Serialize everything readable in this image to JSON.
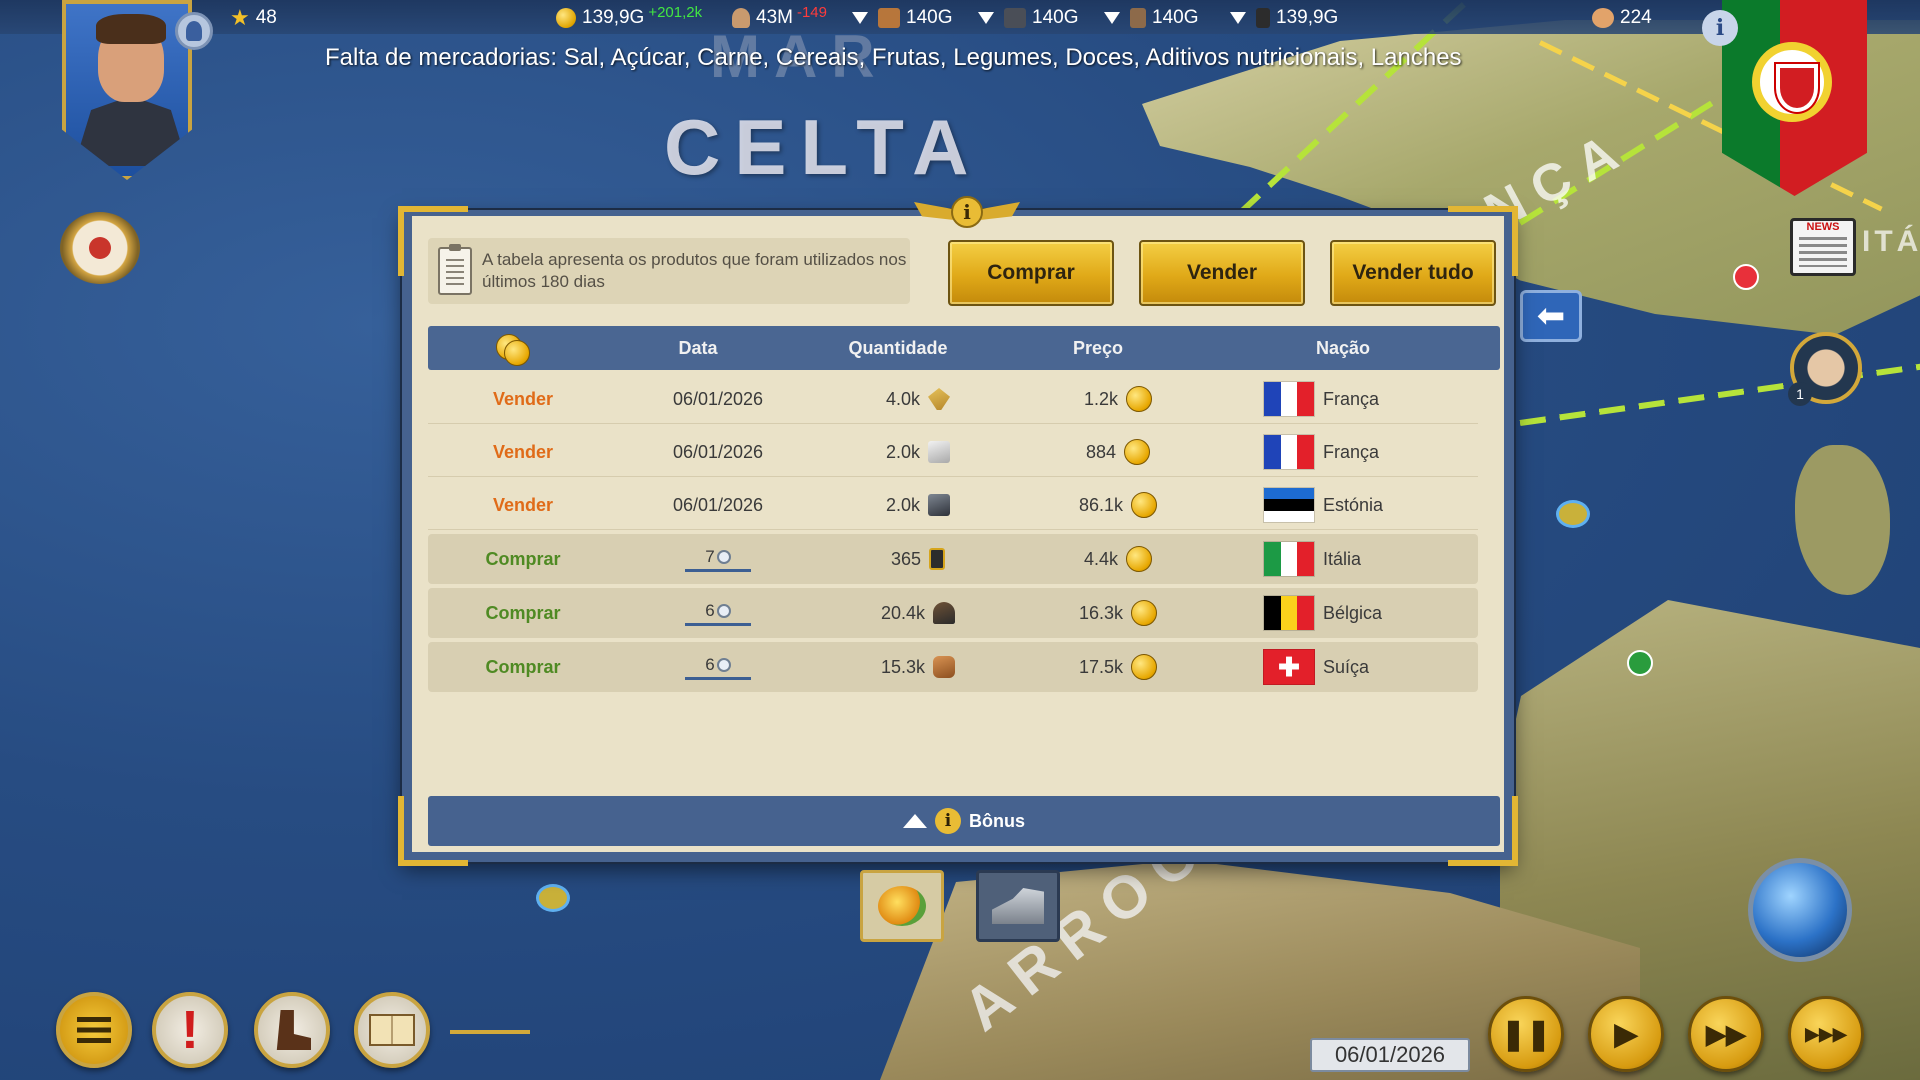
{
  "top_bar": {
    "stars": "48",
    "money": "139,9G",
    "money_delta": "+201,2k",
    "population": "43M",
    "population_delta": "-149",
    "res_1": "140G",
    "res_2": "140G",
    "res_3": "140G",
    "res_4": "139,9G",
    "strength": "224"
  },
  "shortage_text": "Falta de mercadorias: Sal, Açúcar, Carne, Cereais, Frutas, Legumes, Doces, Aditivos nutricionais, Lanches",
  "map": {
    "sea_label_1": "MAR",
    "sea_label_2": "CELTA",
    "country_label_france": "NÇA",
    "country_label_morocco": "ARROCOS",
    "country_label_italy": "ITÁ"
  },
  "news_label": "NEWS",
  "advisor_badge": "1",
  "dialog": {
    "note": "A tabela apresenta os produtos que foram utilizados nos últimos 180 dias",
    "buy_button": "Comprar",
    "sell_button": "Vender",
    "sell_all_button": "Vender tudo",
    "headers": {
      "date": "Data",
      "quantity": "Quantidade",
      "price": "Preço",
      "nation": "Nação"
    },
    "rows": [
      {
        "action": "Vender",
        "date": "06/01/2026",
        "quantity": "4.0k",
        "product_icon": "wheat-icon",
        "price": "1.2k",
        "nation": "França"
      },
      {
        "action": "Vender",
        "date": "06/01/2026",
        "quantity": "2.0k",
        "product_icon": "salt-icon",
        "price": "884",
        "nation": "França"
      },
      {
        "action": "Vender",
        "date": "06/01/2026",
        "quantity": "2.0k",
        "product_icon": "machine-icon",
        "price": "86.1k",
        "nation": "Estónia"
      },
      {
        "action": "Comprar",
        "date": "7",
        "quantity": "365",
        "product_icon": "oil-barrel-icon",
        "price": "4.4k",
        "nation": "Itália"
      },
      {
        "action": "Comprar",
        "date": "6",
        "quantity": "20.4k",
        "product_icon": "ore-icon",
        "price": "16.3k",
        "nation": "Bélgica"
      },
      {
        "action": "Comprar",
        "date": "6",
        "quantity": "15.3k",
        "product_icon": "lumber-icon",
        "price": "17.5k",
        "nation": "Suíça"
      }
    ],
    "bonus_label": "Bônus"
  },
  "current_date": "06/01/2026",
  "colors": {
    "sell_action": "#e06b18",
    "buy_action": "#4f8a23",
    "header_bg": "#4a6692",
    "gold": "#e0a918"
  }
}
